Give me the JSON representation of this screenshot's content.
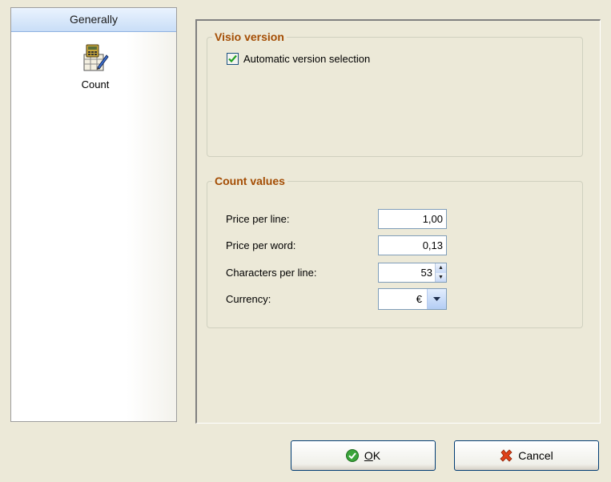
{
  "nav": {
    "header": "Generally",
    "items": [
      {
        "label": "Count",
        "icon": "calculator-pencil-icon"
      }
    ]
  },
  "visio_group": {
    "title": "Visio version",
    "auto_select": {
      "label": "Automatic version selection",
      "checked": true
    }
  },
  "count_group": {
    "title": "Count values",
    "price_per_line": {
      "label": "Price per line:",
      "value": "1,00"
    },
    "price_per_word": {
      "label": "Price per word:",
      "value": "0,13"
    },
    "chars_per_line": {
      "label": "Characters per line:",
      "value": "53"
    },
    "currency": {
      "label": "Currency:",
      "value": "€"
    }
  },
  "buttons": {
    "ok_mnemonic": "O",
    "ok_rest": "K",
    "cancel": "Cancel"
  },
  "colors": {
    "accent_text": "#a44d04",
    "nav_header": "#c9def7",
    "check": "#21a121"
  }
}
